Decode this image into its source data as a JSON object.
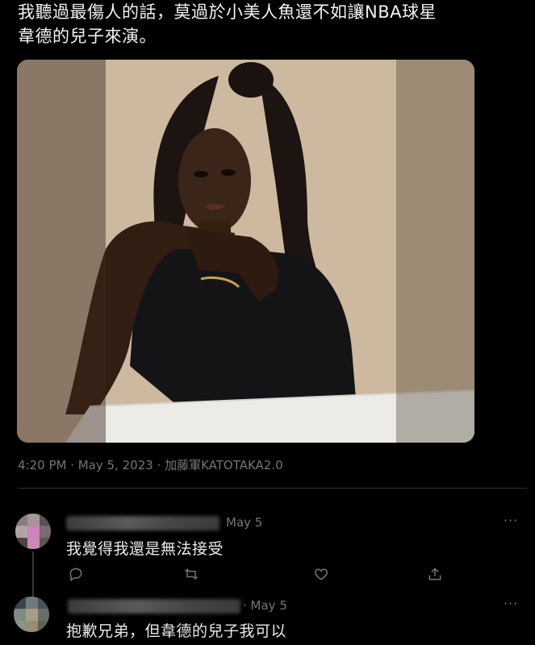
{
  "tweet": {
    "text_line1": "我聽過最傷人的話，莫過於小美人魚還不如讓NBA球星",
    "text_line2": "韋德的兒子來演。",
    "meta": "4:20 PM · May 5, 2023 · 加藤軍KATOTAKA2.0"
  },
  "replies": [
    {
      "date": "May 5",
      "text": "我覺得我還是無法接受",
      "more": "···"
    },
    {
      "date": "· May 5",
      "text": "抱歉兄弟，但韋德的兒子我可以",
      "more": "···"
    }
  ],
  "icons": [
    "reply-icon",
    "retweet-icon",
    "like-icon",
    "share-icon",
    "more-icon"
  ],
  "colors": {
    "background": "#000000",
    "text": "#e7e9ea",
    "muted": "#71767b",
    "divider": "#2f3336"
  }
}
